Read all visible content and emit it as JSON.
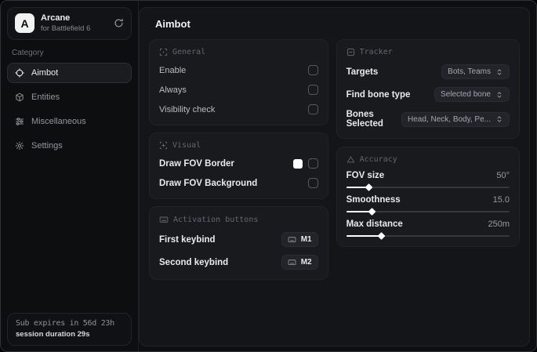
{
  "app": {
    "name": "Arcane",
    "subtitle": "for Battlefield 6",
    "logo_letter": "A"
  },
  "sidebar": {
    "category_label": "Category",
    "items": [
      {
        "label": "Aimbot",
        "active": true
      },
      {
        "label": "Entities",
        "active": false
      },
      {
        "label": "Miscellaneous",
        "active": false
      },
      {
        "label": "Settings",
        "active": false
      }
    ],
    "footer": {
      "line1": "Sub expires in 56d 23h",
      "line2": "session duration 29s"
    }
  },
  "main": {
    "title": "Aimbot",
    "general": {
      "title": "General",
      "rows": [
        {
          "label": "Enable",
          "checked": false
        },
        {
          "label": "Always",
          "checked": false
        },
        {
          "label": "Visibility check",
          "checked": false
        }
      ]
    },
    "visual": {
      "title": "Visual",
      "rows": [
        {
          "label": "Draw FOV Border",
          "swatch": "#ffffff",
          "checked": false
        },
        {
          "label": "Draw FOV Background",
          "checked": false
        }
      ]
    },
    "activation": {
      "title": "Activation buttons",
      "rows": [
        {
          "label": "First keybind",
          "key": "M1"
        },
        {
          "label": "Second keybind",
          "key": "M2"
        }
      ]
    },
    "tracker": {
      "title": "Tracker",
      "rows": [
        {
          "label": "Targets",
          "value": "Bots, Teams"
        },
        {
          "label": "Find bone type",
          "value": "Selected bone"
        },
        {
          "label": "Bones Selected",
          "value": "Head, Neck, Body, Pe..."
        }
      ]
    },
    "accuracy": {
      "title": "Accuracy",
      "sliders": [
        {
          "label": "FOV size",
          "value": "50°",
          "percent": 14
        },
        {
          "label": "Smoothness",
          "value": "15.0",
          "percent": 16
        },
        {
          "label": "Max distance",
          "value": "250m",
          "percent": 22
        }
      ]
    }
  },
  "colors": {
    "accent": "#ffffff",
    "window_bg": "#0d0e10",
    "panel_bg": "#141519",
    "card_bg": "#191a1e"
  }
}
